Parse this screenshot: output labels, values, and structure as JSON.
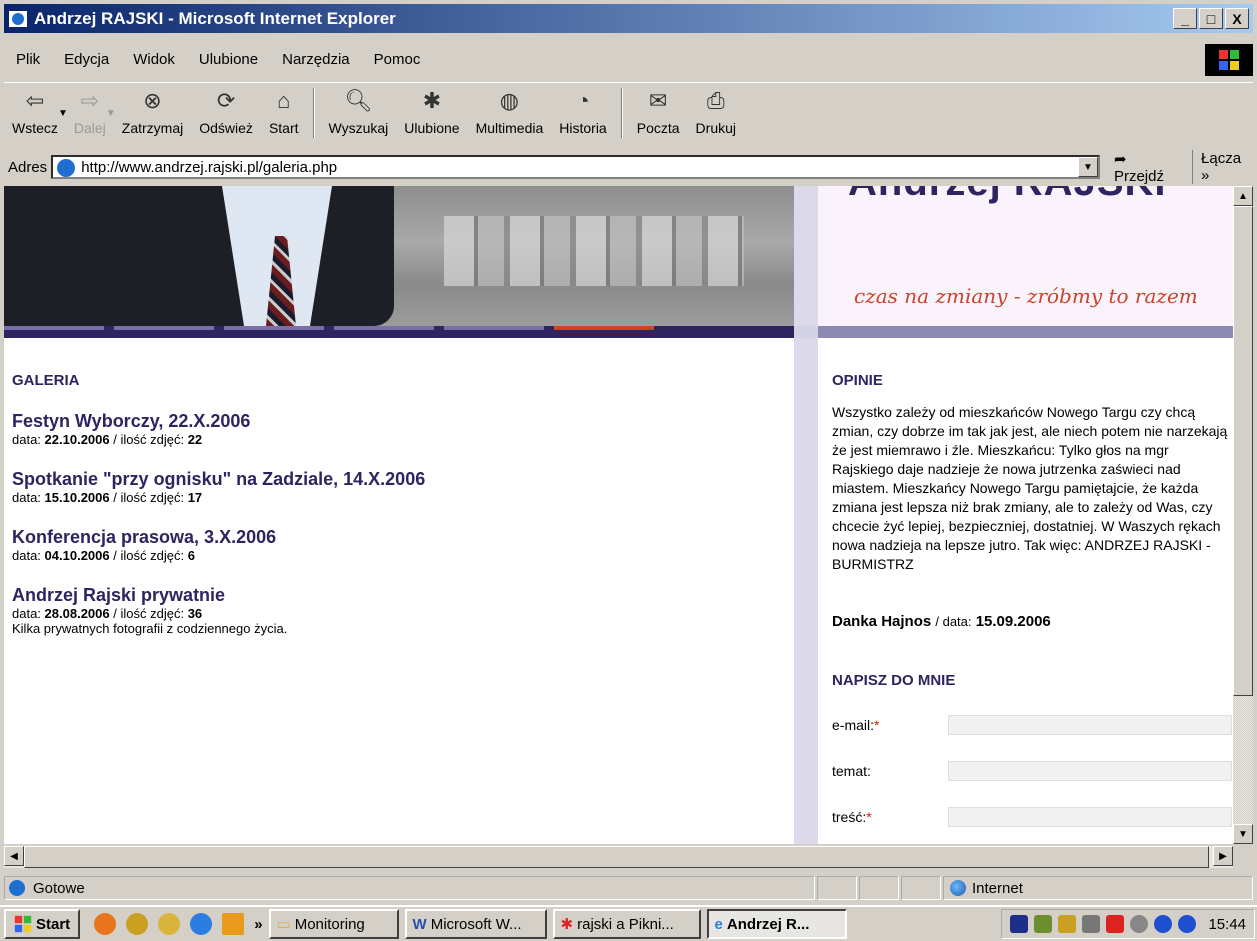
{
  "window": {
    "title": "Andrzej RAJSKI - Microsoft Internet Explorer",
    "min": "_",
    "max": "□",
    "close": "X"
  },
  "menu": [
    "Plik",
    "Edycja",
    "Widok",
    "Ulubione",
    "Narzędzia",
    "Pomoc"
  ],
  "toolbar": {
    "back": "Wstecz",
    "forward": "Dalej",
    "stop": "Zatrzymaj",
    "refresh": "Odśwież",
    "home": "Start",
    "search": "Wyszukaj",
    "favorites": "Ulubione",
    "media": "Multimedia",
    "history": "Historia",
    "mail": "Poczta",
    "print": "Drukuj"
  },
  "address": {
    "label": "Adres",
    "url": "http://www.andrzej.rajski.pl/galeria.php",
    "go": "Przejdź",
    "links": "Łącza »"
  },
  "page": {
    "banner_slogan": "czas na zmiany - zróbmy to razem",
    "gallery_heading": "GALERIA",
    "galleries": [
      {
        "title": "Festyn Wyborczy, 22.X.2006",
        "date_label": "data:",
        "date": "22.10.2006",
        "count_label": "/ ilość zdjęć:",
        "count": "22",
        "desc": ""
      },
      {
        "title": "Spotkanie \"przy ognisku\" na Zadziale, 14.X.2006",
        "date_label": "data:",
        "date": "15.10.2006",
        "count_label": "/ ilość zdjęć:",
        "count": "17",
        "desc": ""
      },
      {
        "title": "Konferencja prasowa, 3.X.2006",
        "date_label": "data:",
        "date": "04.10.2006",
        "count_label": "/ ilość zdjęć:",
        "count": "6",
        "desc": ""
      },
      {
        "title": "Andrzej Rajski prywatnie",
        "date_label": "data:",
        "date": "28.08.2006",
        "count_label": "/ ilość zdjęć:",
        "count": "36",
        "desc": "Kilka prywatnych fotografii z codziennego życia."
      }
    ],
    "opinions_heading": "OPINIE",
    "opinion_text": "Wszystko zależy od mieszkańców Nowego Targu czy chcą zmian, czy dobrze im tak jak jest, ale niech potem nie narzekają że jest miemrawo i źle. Mieszkańcu: Tylko głos na mgr Rajskiego daje nadzieje że nowa jutrzenka zaświeci nad miastem. Mieszkańcy Nowego Targu pamiętajcie, że każda zmiana jest lepsza niż brak zmiany, ale to zależy od Was, czy chcecie żyć lepiej, bezpieczniej, dostatniej. W Waszych rękach nowa nadzieja na lepsze jutro. Tak więc: ANDRZEJ RAJSKI - BURMISTRZ",
    "opinion_author": "Danka Hajnos",
    "opinion_date_label": "/ data:",
    "opinion_date": "15.09.2006",
    "form_heading": "NAPISZ DO MNIE",
    "form": {
      "email": "e-mail:",
      "subject": "temat:",
      "body": "treść:",
      "required": "*"
    }
  },
  "status": {
    "text": "Gotowe",
    "zone": "Internet"
  },
  "taskbar": {
    "start": "Start",
    "tasks": [
      "Monitoring",
      "Microsoft W...",
      "rajski a Pikni...",
      "Andrzej R..."
    ],
    "clock": "15:44"
  }
}
